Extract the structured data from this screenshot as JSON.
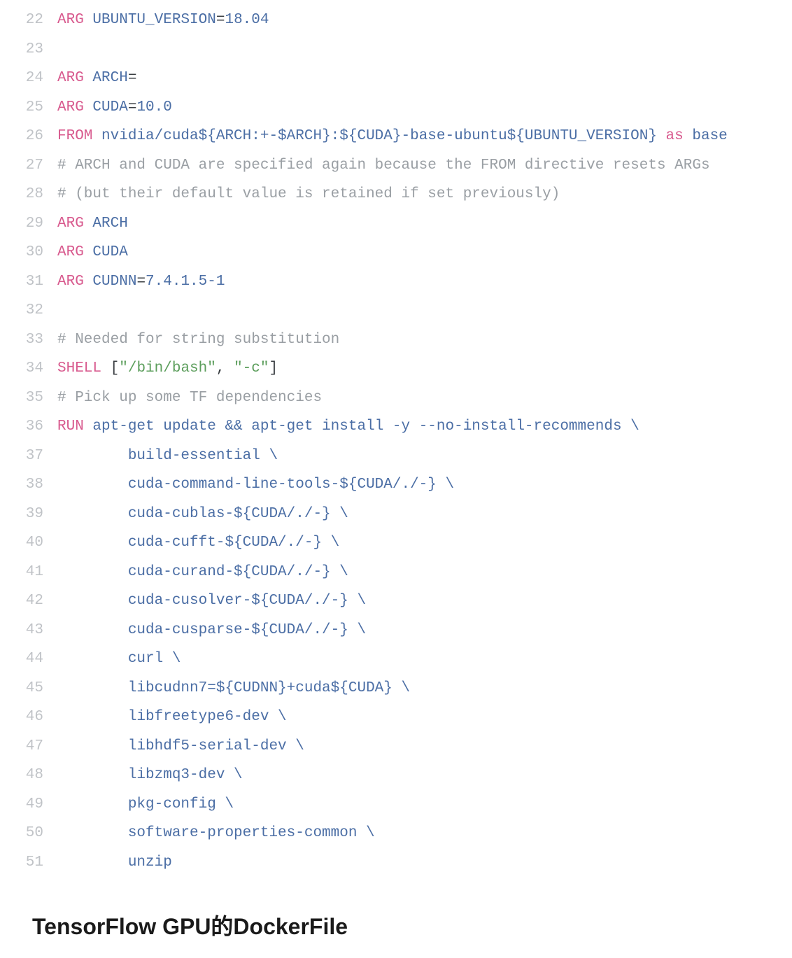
{
  "lines": [
    {
      "n": "22",
      "segs": [
        {
          "c": "kw",
          "t": "ARG "
        },
        {
          "c": "id",
          "t": "UBUNTU_VERSION"
        },
        {
          "c": "op",
          "t": "="
        },
        {
          "c": "id",
          "t": "18.04"
        }
      ]
    },
    {
      "n": "23",
      "segs": []
    },
    {
      "n": "24",
      "segs": [
        {
          "c": "kw",
          "t": "ARG "
        },
        {
          "c": "id",
          "t": "ARCH"
        },
        {
          "c": "op",
          "t": "="
        }
      ]
    },
    {
      "n": "25",
      "segs": [
        {
          "c": "kw",
          "t": "ARG "
        },
        {
          "c": "id",
          "t": "CUDA"
        },
        {
          "c": "op",
          "t": "="
        },
        {
          "c": "id",
          "t": "10.0"
        }
      ]
    },
    {
      "n": "26",
      "segs": [
        {
          "c": "kw",
          "t": "FROM "
        },
        {
          "c": "id",
          "t": "nvidia/cuda${ARCH:+-$ARCH}:${CUDA}-base-ubuntu${UBUNTU_VERSION}"
        },
        {
          "c": "kw",
          "t": " as "
        },
        {
          "c": "id",
          "t": "base"
        }
      ]
    },
    {
      "n": "27",
      "segs": [
        {
          "c": "comment",
          "t": "# ARCH and CUDA are specified again because the FROM directive resets ARGs"
        }
      ]
    },
    {
      "n": "28",
      "segs": [
        {
          "c": "comment",
          "t": "# (but their default value is retained if set previously)"
        }
      ]
    },
    {
      "n": "29",
      "segs": [
        {
          "c": "kw",
          "t": "ARG "
        },
        {
          "c": "id",
          "t": "ARCH"
        }
      ]
    },
    {
      "n": "30",
      "segs": [
        {
          "c": "kw",
          "t": "ARG "
        },
        {
          "c": "id",
          "t": "CUDA"
        }
      ]
    },
    {
      "n": "31",
      "segs": [
        {
          "c": "kw",
          "t": "ARG "
        },
        {
          "c": "id",
          "t": "CUDNN"
        },
        {
          "c": "op",
          "t": "="
        },
        {
          "c": "id",
          "t": "7.4.1.5-1"
        }
      ]
    },
    {
      "n": "32",
      "segs": []
    },
    {
      "n": "33",
      "segs": [
        {
          "c": "comment",
          "t": "# Needed for string substitution"
        }
      ]
    },
    {
      "n": "34",
      "segs": [
        {
          "c": "kw",
          "t": "SHELL "
        },
        {
          "c": "op",
          "t": "["
        },
        {
          "c": "str",
          "t": "\"/bin/bash\""
        },
        {
          "c": "op",
          "t": ", "
        },
        {
          "c": "str",
          "t": "\"-c\""
        },
        {
          "c": "op",
          "t": "]"
        }
      ]
    },
    {
      "n": "35",
      "segs": [
        {
          "c": "comment",
          "t": "# Pick up some TF dependencies"
        }
      ]
    },
    {
      "n": "36",
      "segs": [
        {
          "c": "kw",
          "t": "RUN "
        },
        {
          "c": "id",
          "t": "apt-get update && apt-get install -y --no-install-recommends \\"
        }
      ]
    },
    {
      "n": "37",
      "segs": [
        {
          "c": "id",
          "t": "        build-essential \\"
        }
      ]
    },
    {
      "n": "38",
      "segs": [
        {
          "c": "id",
          "t": "        cuda-command-line-tools-${CUDA/./-} \\"
        }
      ]
    },
    {
      "n": "39",
      "segs": [
        {
          "c": "id",
          "t": "        cuda-cublas-${CUDA/./-} \\"
        }
      ]
    },
    {
      "n": "40",
      "segs": [
        {
          "c": "id",
          "t": "        cuda-cufft-${CUDA/./-} \\"
        }
      ]
    },
    {
      "n": "41",
      "segs": [
        {
          "c": "id",
          "t": "        cuda-curand-${CUDA/./-} \\"
        }
      ]
    },
    {
      "n": "42",
      "segs": [
        {
          "c": "id",
          "t": "        cuda-cusolver-${CUDA/./-} \\"
        }
      ]
    },
    {
      "n": "43",
      "segs": [
        {
          "c": "id",
          "t": "        cuda-cusparse-${CUDA/./-} \\"
        }
      ]
    },
    {
      "n": "44",
      "segs": [
        {
          "c": "id",
          "t": "        curl \\"
        }
      ]
    },
    {
      "n": "45",
      "segs": [
        {
          "c": "id",
          "t": "        libcudnn7=${CUDNN}+cuda${CUDA} \\"
        }
      ]
    },
    {
      "n": "46",
      "segs": [
        {
          "c": "id",
          "t": "        libfreetype6-dev \\"
        }
      ]
    },
    {
      "n": "47",
      "segs": [
        {
          "c": "id",
          "t": "        libhdf5-serial-dev \\"
        }
      ]
    },
    {
      "n": "48",
      "segs": [
        {
          "c": "id",
          "t": "        libzmq3-dev \\"
        }
      ]
    },
    {
      "n": "49",
      "segs": [
        {
          "c": "id",
          "t": "        pkg-config \\"
        }
      ]
    },
    {
      "n": "50",
      "segs": [
        {
          "c": "id",
          "t": "        software-properties-common \\"
        }
      ]
    },
    {
      "n": "51",
      "segs": [
        {
          "c": "id",
          "t": "        unzip"
        }
      ]
    }
  ],
  "caption": "TensorFlow GPU的DockerFile"
}
